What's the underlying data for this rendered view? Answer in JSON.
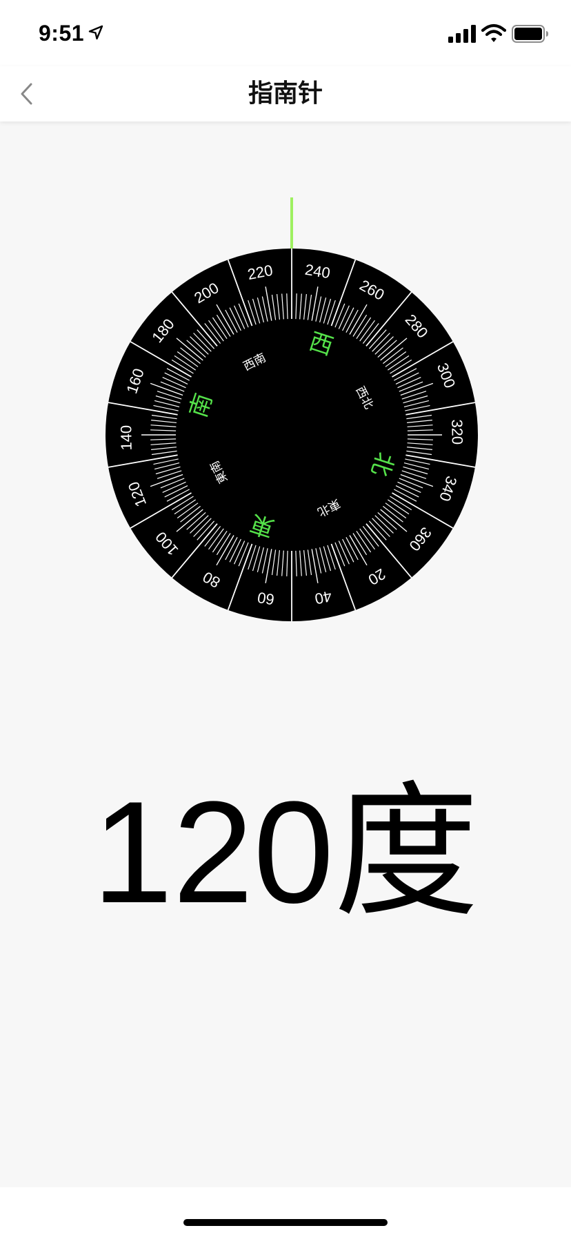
{
  "status_bar": {
    "time": "9:51",
    "icons": [
      "location-arrow-icon",
      "signal-icon",
      "wifi-icon",
      "battery-icon"
    ]
  },
  "nav": {
    "title": "指南针",
    "back_icon": "chevron-left-icon"
  },
  "compass": {
    "heading_degrees": 120,
    "degree_labels": [
      "20",
      "40",
      "60",
      "80",
      "100",
      "120",
      "140",
      "160",
      "180",
      "200",
      "220",
      "240",
      "260",
      "280",
      "300",
      "320",
      "340",
      "360"
    ],
    "cardinals": {
      "north": "北",
      "east": "東",
      "south": "南",
      "west": "西"
    },
    "intercardinals": {
      "northeast": "東北",
      "southeast": "東南",
      "southwest": "西南",
      "northwest": "西北"
    },
    "colors": {
      "dial": "#000000",
      "ticks": "#ffffff",
      "cardinal": "#55e24a",
      "pointer": "#9ef060"
    }
  },
  "readout": {
    "value": "120",
    "unit": "度"
  }
}
